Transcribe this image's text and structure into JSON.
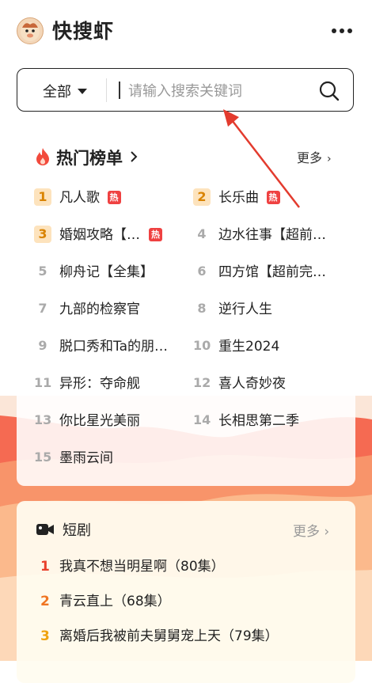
{
  "app": {
    "title": "快搜虾"
  },
  "search": {
    "scope": "全部",
    "placeholder": "请输入搜索关键词"
  },
  "hot_list": {
    "title": "热门榜单",
    "more": "更多",
    "badge_label": "热",
    "items": [
      {
        "rank": "1",
        "title": "凡人歌",
        "hot": true
      },
      {
        "rank": "2",
        "title": "长乐曲",
        "hot": true
      },
      {
        "rank": "3",
        "title": "婚姻攻略【…",
        "hot": true
      },
      {
        "rank": "4",
        "title": "边水往事【超前…",
        "hot": false
      },
      {
        "rank": "5",
        "title": "柳舟记【全集】",
        "hot": false
      },
      {
        "rank": "6",
        "title": "四方馆【超前完…",
        "hot": false
      },
      {
        "rank": "7",
        "title": "九部的检察官",
        "hot": false
      },
      {
        "rank": "8",
        "title": "逆行人生",
        "hot": false
      },
      {
        "rank": "9",
        "title": "脱口秀和Ta的朋…",
        "hot": false
      },
      {
        "rank": "10",
        "title": "重生2024",
        "hot": false
      },
      {
        "rank": "11",
        "title": "异形：夺命舰",
        "hot": false
      },
      {
        "rank": "12",
        "title": "喜人奇妙夜",
        "hot": false
      },
      {
        "rank": "13",
        "title": "你比星光美丽",
        "hot": false
      },
      {
        "rank": "14",
        "title": "长相思第二季",
        "hot": false
      },
      {
        "rank": "15",
        "title": "墨雨云间",
        "hot": false
      }
    ]
  },
  "short_drama": {
    "title": "短剧",
    "more": "更多 ›",
    "items": [
      {
        "rank": "1",
        "title": "我真不想当明星啊（80集）",
        "color": "#e8402c"
      },
      {
        "rank": "2",
        "title": "青云直上（68集）",
        "color": "#f07522"
      },
      {
        "rank": "3",
        "title": "离婚后我被前夫舅舅宠上天（79集）",
        "color": "#efa20f"
      }
    ]
  },
  "colors": {
    "accent": "#ef4141",
    "wave_red": "#f0654e",
    "wave_orange": "#f8b383"
  }
}
